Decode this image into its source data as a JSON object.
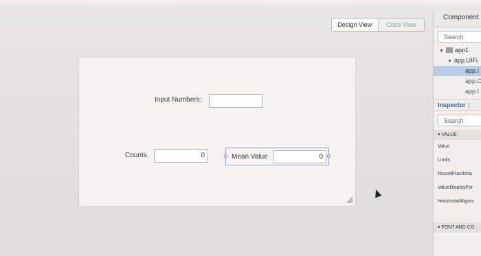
{
  "toolbar": {
    "design_view": "Design View",
    "code_view": "Code View"
  },
  "canvas": {
    "input_label": "Input Numbers:",
    "counts_label": "Counts",
    "counts_value": "0",
    "mean_label": "Mean Value",
    "mean_value": "0"
  },
  "panel": {
    "header": "Component",
    "search_placeholder": "Search",
    "tree": [
      "app1",
      "app.UIFi",
      "app.I",
      "app.C",
      "app.I"
    ],
    "inspector_tab": "Inspector",
    "inspector_sep": "|",
    "search2_placeholder": "Search",
    "value_section": "VALUE",
    "properties": [
      "Value",
      "Limits",
      "RoundFractiona",
      "ValueDisplayFor",
      "HorizontalAlignm"
    ],
    "font_section": "FONT AND CO"
  }
}
